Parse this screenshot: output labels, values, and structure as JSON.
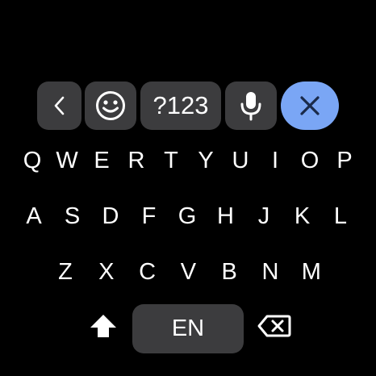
{
  "toolbar": {
    "back_icon": "chevron-left-icon",
    "emoji_icon": "emoji-icon",
    "symbols_label": "?123",
    "mic_icon": "microphone-icon",
    "clear_icon": "close-icon",
    "clear_color": "#7aa6f5"
  },
  "keyboard": {
    "row1": [
      "Q",
      "W",
      "E",
      "R",
      "T",
      "Y",
      "U",
      "I",
      "O",
      "P"
    ],
    "row2": [
      "A",
      "S",
      "D",
      "F",
      "G",
      "H",
      "J",
      "K",
      "L"
    ],
    "row3": [
      "Z",
      "X",
      "C",
      "V",
      "B",
      "N",
      "M"
    ],
    "shift_icon": "shift-icon",
    "space_label": "EN",
    "backspace_icon": "backspace-icon"
  },
  "colors": {
    "background": "#000000",
    "key_fill": "#3c3c3e",
    "text": "#ffffff",
    "accent": "#7aa6f5"
  }
}
